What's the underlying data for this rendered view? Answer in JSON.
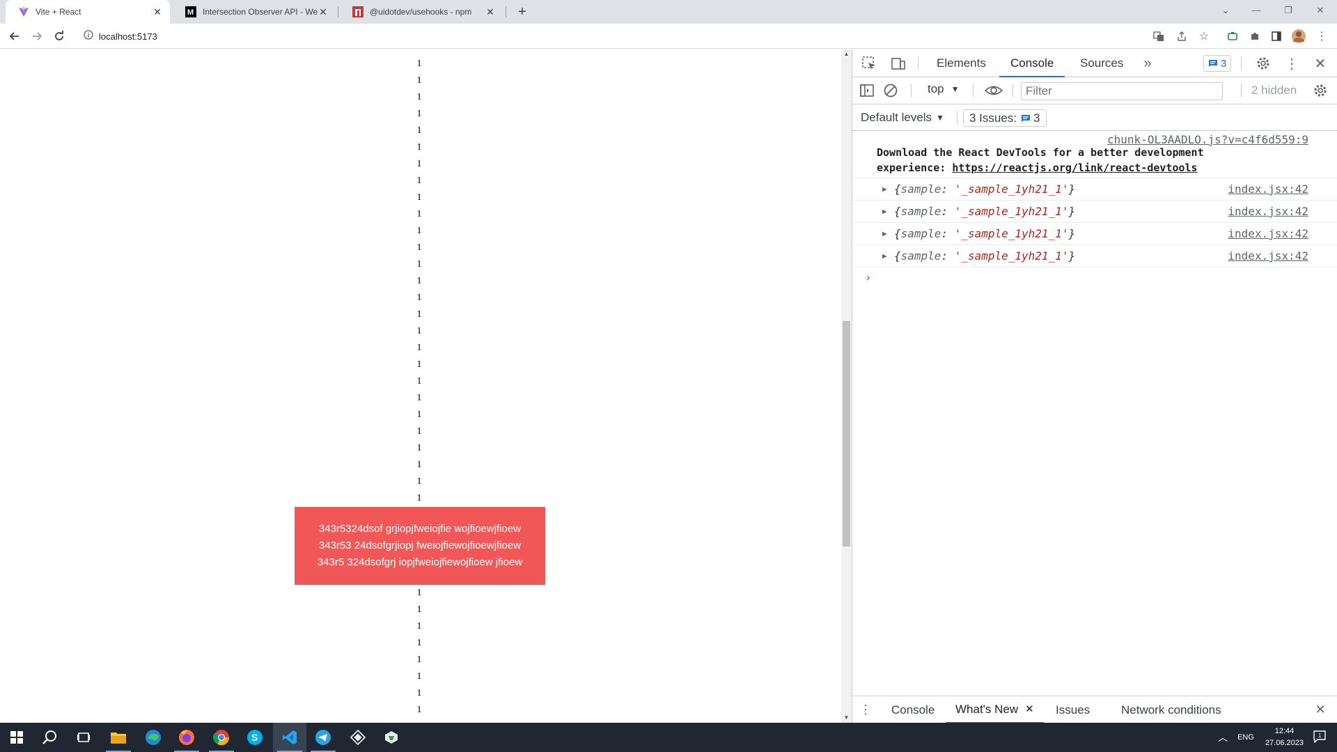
{
  "browser": {
    "tabs": [
      {
        "title": "Vite + React",
        "icon": "vite-icon",
        "active": true
      },
      {
        "title": "Intersection Observer API - Web",
        "icon": "mdn-icon",
        "active": false
      },
      {
        "title": "@uidotdev/usehooks - npm",
        "icon": "npm-icon",
        "active": false
      }
    ],
    "url": "localhost:5173"
  },
  "page": {
    "filler_char": "1",
    "ones_above": 27,
    "ones_below": 8,
    "red_box_lines": [
      "343r5324dsof grjiopjfweiojfie wojfioewjfioew",
      "343r53 24dsofgrjiopj fweiojfiewojfioewjfioew",
      "343r5 324dsofgrj iopjfweiojfiewojfioew jfioew"
    ],
    "red_box_color": "#f25757"
  },
  "devtools": {
    "tabs": [
      "Elements",
      "Console",
      "Sources"
    ],
    "active_tab": "Console",
    "issues_badge": "3",
    "context": "top",
    "filter_placeholder": "Filter",
    "hidden_text": "2 hidden",
    "levels_label": "Default levels",
    "issues_label": "3 Issues:",
    "issues_count": "3",
    "messages": {
      "first_source": "chunk-OL3AADLO.js?v=c4f6d559:9",
      "first_text": "Download the React DevTools for a better development experience:",
      "first_link": "https://reactjs.org/link/react-devtools",
      "objects": [
        {
          "key": "sample",
          "value": "'_sample_1yh21_1'",
          "source": "index.jsx:42"
        },
        {
          "key": "sample",
          "value": "'_sample_1yh21_1'",
          "source": "index.jsx:42"
        },
        {
          "key": "sample",
          "value": "'_sample_1yh21_1'",
          "source": "index.jsx:42"
        },
        {
          "key": "sample",
          "value": "'_sample_1yh21_1'",
          "source": "index.jsx:42"
        }
      ]
    },
    "drawer_tabs": [
      "Console",
      "What's New",
      "Issues",
      "Network conditions"
    ],
    "drawer_active": "What's New"
  },
  "taskbar": {
    "lang": "ENG",
    "time": "12:44",
    "date": "27.06.2023"
  }
}
